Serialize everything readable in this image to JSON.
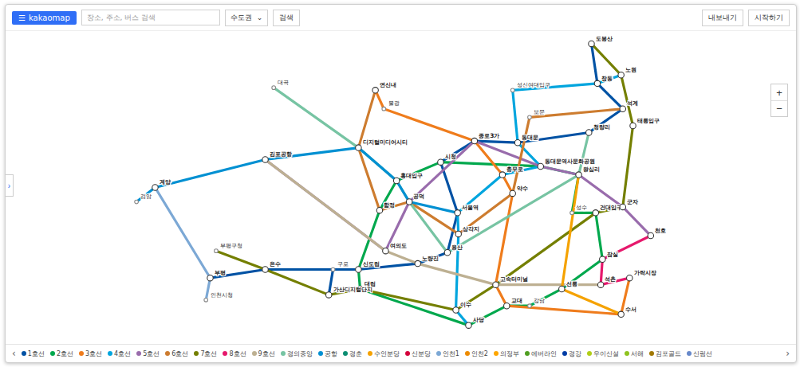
{
  "header": {
    "menu_icon": "☰",
    "logo": "kakaomap",
    "search_placeholder": "장소, 주소, 버스 검색",
    "region": "수도권",
    "region_caret": "⌄",
    "search_button": "검색",
    "buttons": [
      "내보내기",
      "시작하기"
    ]
  },
  "zoom": [
    "+",
    "−"
  ],
  "side_toggle": "›",
  "stations": [
    {
      "name": "도봉산",
      "transfer": true
    },
    {
      "name": "창동",
      "transfer": true
    },
    {
      "name": "노원",
      "transfer": true
    },
    {
      "name": "석계",
      "transfer": true
    },
    {
      "name": "태릉입구",
      "transfer": true
    },
    {
      "name": "청량리",
      "transfer": true
    },
    {
      "name": "성신여대입구",
      "transfer": false
    },
    {
      "name": "보문",
      "transfer": false
    },
    {
      "name": "동대문",
      "transfer": true
    },
    {
      "name": "종로3가",
      "transfer": true
    },
    {
      "name": "시청",
      "transfer": true
    },
    {
      "name": "서울역",
      "transfer": true
    },
    {
      "name": "동대문역사문화공원",
      "transfer": true
    },
    {
      "name": "충무로",
      "transfer": true
    },
    {
      "name": "약수",
      "transfer": true
    },
    {
      "name": "왕십리",
      "transfer": true
    },
    {
      "name": "성수",
      "transfer": false
    },
    {
      "name": "건대입구",
      "transfer": true
    },
    {
      "name": "군자",
      "transfer": true
    },
    {
      "name": "천호",
      "transfer": true
    },
    {
      "name": "잠실",
      "transfer": true
    },
    {
      "name": "석촌",
      "transfer": true
    },
    {
      "name": "가락시장",
      "transfer": true
    },
    {
      "name": "수서",
      "transfer": true
    },
    {
      "name": "선릉",
      "transfer": true
    },
    {
      "name": "강남",
      "transfer": false
    },
    {
      "name": "교대",
      "transfer": true
    },
    {
      "name": "고속터미널",
      "transfer": true
    },
    {
      "name": "사당",
      "transfer": true
    },
    {
      "name": "이수",
      "transfer": true
    },
    {
      "name": "삼각지",
      "transfer": true
    },
    {
      "name": "용산",
      "transfer": true
    },
    {
      "name": "노량진",
      "transfer": true
    },
    {
      "name": "여의도",
      "transfer": true
    },
    {
      "name": "공덕",
      "transfer": true
    },
    {
      "name": "합정",
      "transfer": true
    },
    {
      "name": "홍대입구",
      "transfer": true
    },
    {
      "name": "디지털미디어시티",
      "transfer": true
    },
    {
      "name": "불광",
      "transfer": false
    },
    {
      "name": "연신내",
      "transfer": true
    },
    {
      "name": "대곡",
      "transfer": false
    },
    {
      "name": "김포공항",
      "transfer": true
    },
    {
      "name": "신도림",
      "transfer": true
    },
    {
      "name": "대림",
      "transfer": true
    },
    {
      "name": "구로",
      "transfer": false
    },
    {
      "name": "가산디지털단지",
      "transfer": true
    },
    {
      "name": "온수",
      "transfer": true
    },
    {
      "name": "부평구청",
      "transfer": false
    },
    {
      "name": "부평",
      "transfer": true
    },
    {
      "name": "계양",
      "transfer": true
    },
    {
      "name": "검암",
      "transfer": false
    },
    {
      "name": "인천시청",
      "transfer": false
    }
  ],
  "lines": [
    {
      "name": "1호선",
      "color": "#0052A4",
      "paths": [
        [
          0,
          1,
          3,
          5,
          8,
          9,
          10,
          11,
          31,
          32,
          42,
          44,
          46,
          48
        ],
        [
          44,
          45
        ]
      ]
    },
    {
      "name": "2호선",
      "color": "#00A84D",
      "paths": [
        [
          10,
          12,
          15,
          16,
          17,
          20,
          24,
          25,
          26,
          28,
          43,
          42,
          35,
          36,
          10
        ]
      ]
    },
    {
      "name": "3호선",
      "color": "#EF7C1C",
      "paths": [
        [
          39,
          38,
          9,
          13,
          14,
          27,
          26,
          23,
          22
        ]
      ]
    },
    {
      "name": "4호선",
      "color": "#00A5DE",
      "paths": [
        [
          2,
          1,
          6,
          8,
          12,
          13,
          11,
          30,
          29,
          28
        ]
      ]
    },
    {
      "name": "5호선",
      "color": "#996CAC",
      "paths": [
        [
          41,
          33,
          34,
          9,
          12,
          15,
          18,
          19
        ]
      ]
    },
    {
      "name": "6호선",
      "color": "#CD7C2F",
      "paths": [
        [
          39,
          37,
          35,
          34,
          30,
          14,
          7,
          3
        ]
      ]
    },
    {
      "name": "7호선",
      "color": "#747F00",
      "paths": [
        [
          0,
          2,
          4,
          18,
          17,
          27,
          29,
          43,
          45,
          46,
          47
        ]
      ]
    },
    {
      "name": "8호선",
      "color": "#E6186C",
      "paths": [
        [
          19,
          20,
          21,
          22
        ]
      ]
    },
    {
      "name": "9호선",
      "color": "#BDB092",
      "paths": [
        [
          41,
          33,
          32,
          27,
          21
        ]
      ]
    },
    {
      "name": "경의중앙",
      "color": "#77C4A3",
      "paths": [
        [
          40,
          37,
          36,
          34,
          31,
          15,
          5
        ]
      ]
    },
    {
      "name": "공항",
      "color": "#0090D2",
      "paths": [
        [
          50,
          49,
          41,
          37,
          36,
          34,
          11
        ]
      ]
    },
    {
      "name": "수인분당",
      "color": "#F5A200",
      "paths": [
        [
          15,
          24,
          23
        ]
      ]
    },
    {
      "name": "인천1",
      "color": "#7CA8D5",
      "paths": [
        [
          49,
          48,
          51
        ]
      ]
    }
  ],
  "legend": {
    "prev": "‹",
    "next": "›",
    "items": [
      {
        "name": "1호선",
        "color": "#0052A4"
      },
      {
        "name": "2호선",
        "color": "#00A84D"
      },
      {
        "name": "3호선",
        "color": "#EF7C1C"
      },
      {
        "name": "4호선",
        "color": "#00A5DE"
      },
      {
        "name": "5호선",
        "color": "#996CAC"
      },
      {
        "name": "6호선",
        "color": "#CD7C2F"
      },
      {
        "name": "7호선",
        "color": "#747F00"
      },
      {
        "name": "8호선",
        "color": "#E6186C"
      },
      {
        "name": "9호선",
        "color": "#BDB092"
      },
      {
        "name": "경의중앙",
        "color": "#77C4A3"
      },
      {
        "name": "공항",
        "color": "#0090D2"
      },
      {
        "name": "경춘",
        "color": "#0C8E72"
      },
      {
        "name": "수인분당",
        "color": "#F5A200"
      },
      {
        "name": "신분당",
        "color": "#D4003B"
      },
      {
        "name": "인천1",
        "color": "#7CA8D5"
      },
      {
        "name": "인천2",
        "color": "#ED8B00"
      },
      {
        "name": "의정부",
        "color": "#FDA600"
      },
      {
        "name": "에버라인",
        "color": "#509F22"
      },
      {
        "name": "경강",
        "color": "#003DA5"
      },
      {
        "name": "우이신설",
        "color": "#B0CE18"
      },
      {
        "name": "서해",
        "color": "#8FC31F"
      },
      {
        "name": "김포골드",
        "color": "#A17800"
      },
      {
        "name": "신림선",
        "color": "#6789CA"
      }
    ]
  }
}
